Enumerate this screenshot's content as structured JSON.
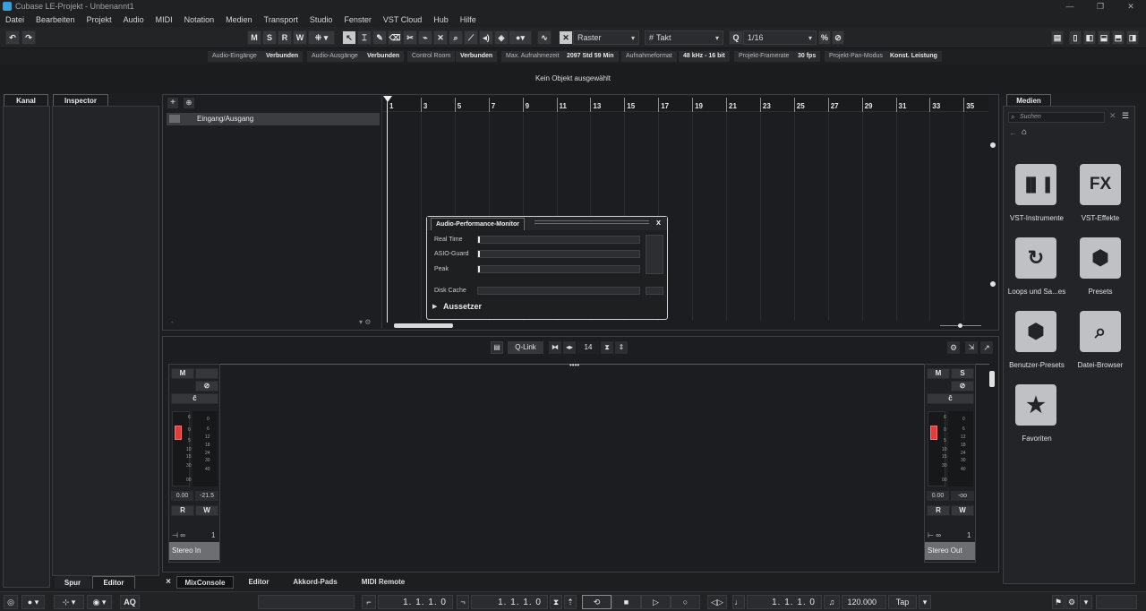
{
  "window": {
    "title": "Cubase LE-Projekt - Unbenannt1"
  },
  "menu": [
    "Datei",
    "Bearbeiten",
    "Projekt",
    "Audio",
    "MIDI",
    "Notation",
    "Medien",
    "Transport",
    "Studio",
    "Fenster",
    "VST Cloud",
    "Hub",
    "Hilfe"
  ],
  "toolbar": {
    "m": "M",
    "s": "S",
    "r": "R",
    "w": "W",
    "snap_label": "Raster",
    "grid_label": "Takt",
    "quantize_label": "1/16"
  },
  "status": {
    "audio_in_label": "Audio-Eingänge",
    "audio_in_value": "Verbunden",
    "audio_out_label": "Audio-Ausgänge",
    "audio_out_value": "Verbunden",
    "control_room_label": "Control Room",
    "control_room_value": "Verbunden",
    "rec_time_label": "Max. Aufnahmezeit",
    "rec_time_value": "2097 Std 59 Min",
    "rec_format_label": "Aufnahmeformat",
    "rec_format_value": "48 kHz - 16 bit",
    "framerate_label": "Projekt-Framerate",
    "framerate_value": "30 fps",
    "pan_label": "Projekt-Pan-Modus",
    "pan_value": "Konst. Leistung"
  },
  "info_line": "Kein Objekt ausgewählt",
  "left_tabs": {
    "kanal": "Kanal",
    "inspector": "Inspector",
    "spur": "Spur",
    "editor": "Editor"
  },
  "project": {
    "track_name": "Eingang/Ausgang",
    "ruler": [
      "1",
      "3",
      "5",
      "7",
      "9",
      "11",
      "13",
      "15",
      "17",
      "19",
      "21",
      "23",
      "25",
      "27",
      "29",
      "31",
      "33",
      "35"
    ]
  },
  "apm": {
    "title": "Audio-Performance-Monitor",
    "close": "x",
    "real_time": "Real Time",
    "asio_guard": "ASIO-Guard",
    "peak": "Peak",
    "disk_cache": "Disk Cache",
    "dropouts": "Aussetzer"
  },
  "mixer": {
    "qlink": "Q-Link",
    "channels_visible": "14",
    "stereo_in": {
      "name": "Stereo In",
      "mute": "M",
      "read": "R",
      "write": "W",
      "volume": "0.00",
      "peak": "-21.5",
      "output_index": "1"
    },
    "stereo_out": {
      "name": "Stereo Out",
      "mute": "M",
      "solo": "S",
      "read": "R",
      "write": "W",
      "volume": "0.00",
      "peak": "-oo",
      "output_index": "1"
    },
    "scale_left": [
      "6",
      "0",
      "5",
      "10",
      "15",
      "30",
      "00"
    ],
    "scale_right": [
      "6",
      "0",
      "6",
      "12",
      "18",
      "24",
      "30",
      "40"
    ]
  },
  "bottom_tabs": {
    "close": "×",
    "mixconsole": "MixConsole",
    "editor": "Editor",
    "chord_pads": "Akkord-Pads",
    "midi_remote": "MIDI Remote"
  },
  "media": {
    "title": "Medien",
    "search_placeholder": "Suchen",
    "tiles": [
      {
        "label": "VST-Instrumente",
        "glyph": "▐▌▐"
      },
      {
        "label": "VST-Effekte",
        "glyph": "FX"
      },
      {
        "label": "Loops und Sa...es",
        "glyph": "↻"
      },
      {
        "label": "Presets",
        "glyph": "⬢"
      },
      {
        "label": "Benutzer-Presets",
        "glyph": "⬢"
      },
      {
        "label": "Datei-Browser",
        "glyph": "⌕"
      },
      {
        "label": "Favoriten",
        "glyph": "★"
      }
    ]
  },
  "transport": {
    "aq": "AQ",
    "left_locator": "1. 1. 1. 0",
    "right_locator": "1. 1. 1. 0",
    "position": "1. 1. 1. 0",
    "tempo": "120.000",
    "tap": "Tap"
  },
  "colors": {
    "accent_red": "#e33b3b",
    "panel_bg": "#232427",
    "tile": "#bfc1c4"
  }
}
